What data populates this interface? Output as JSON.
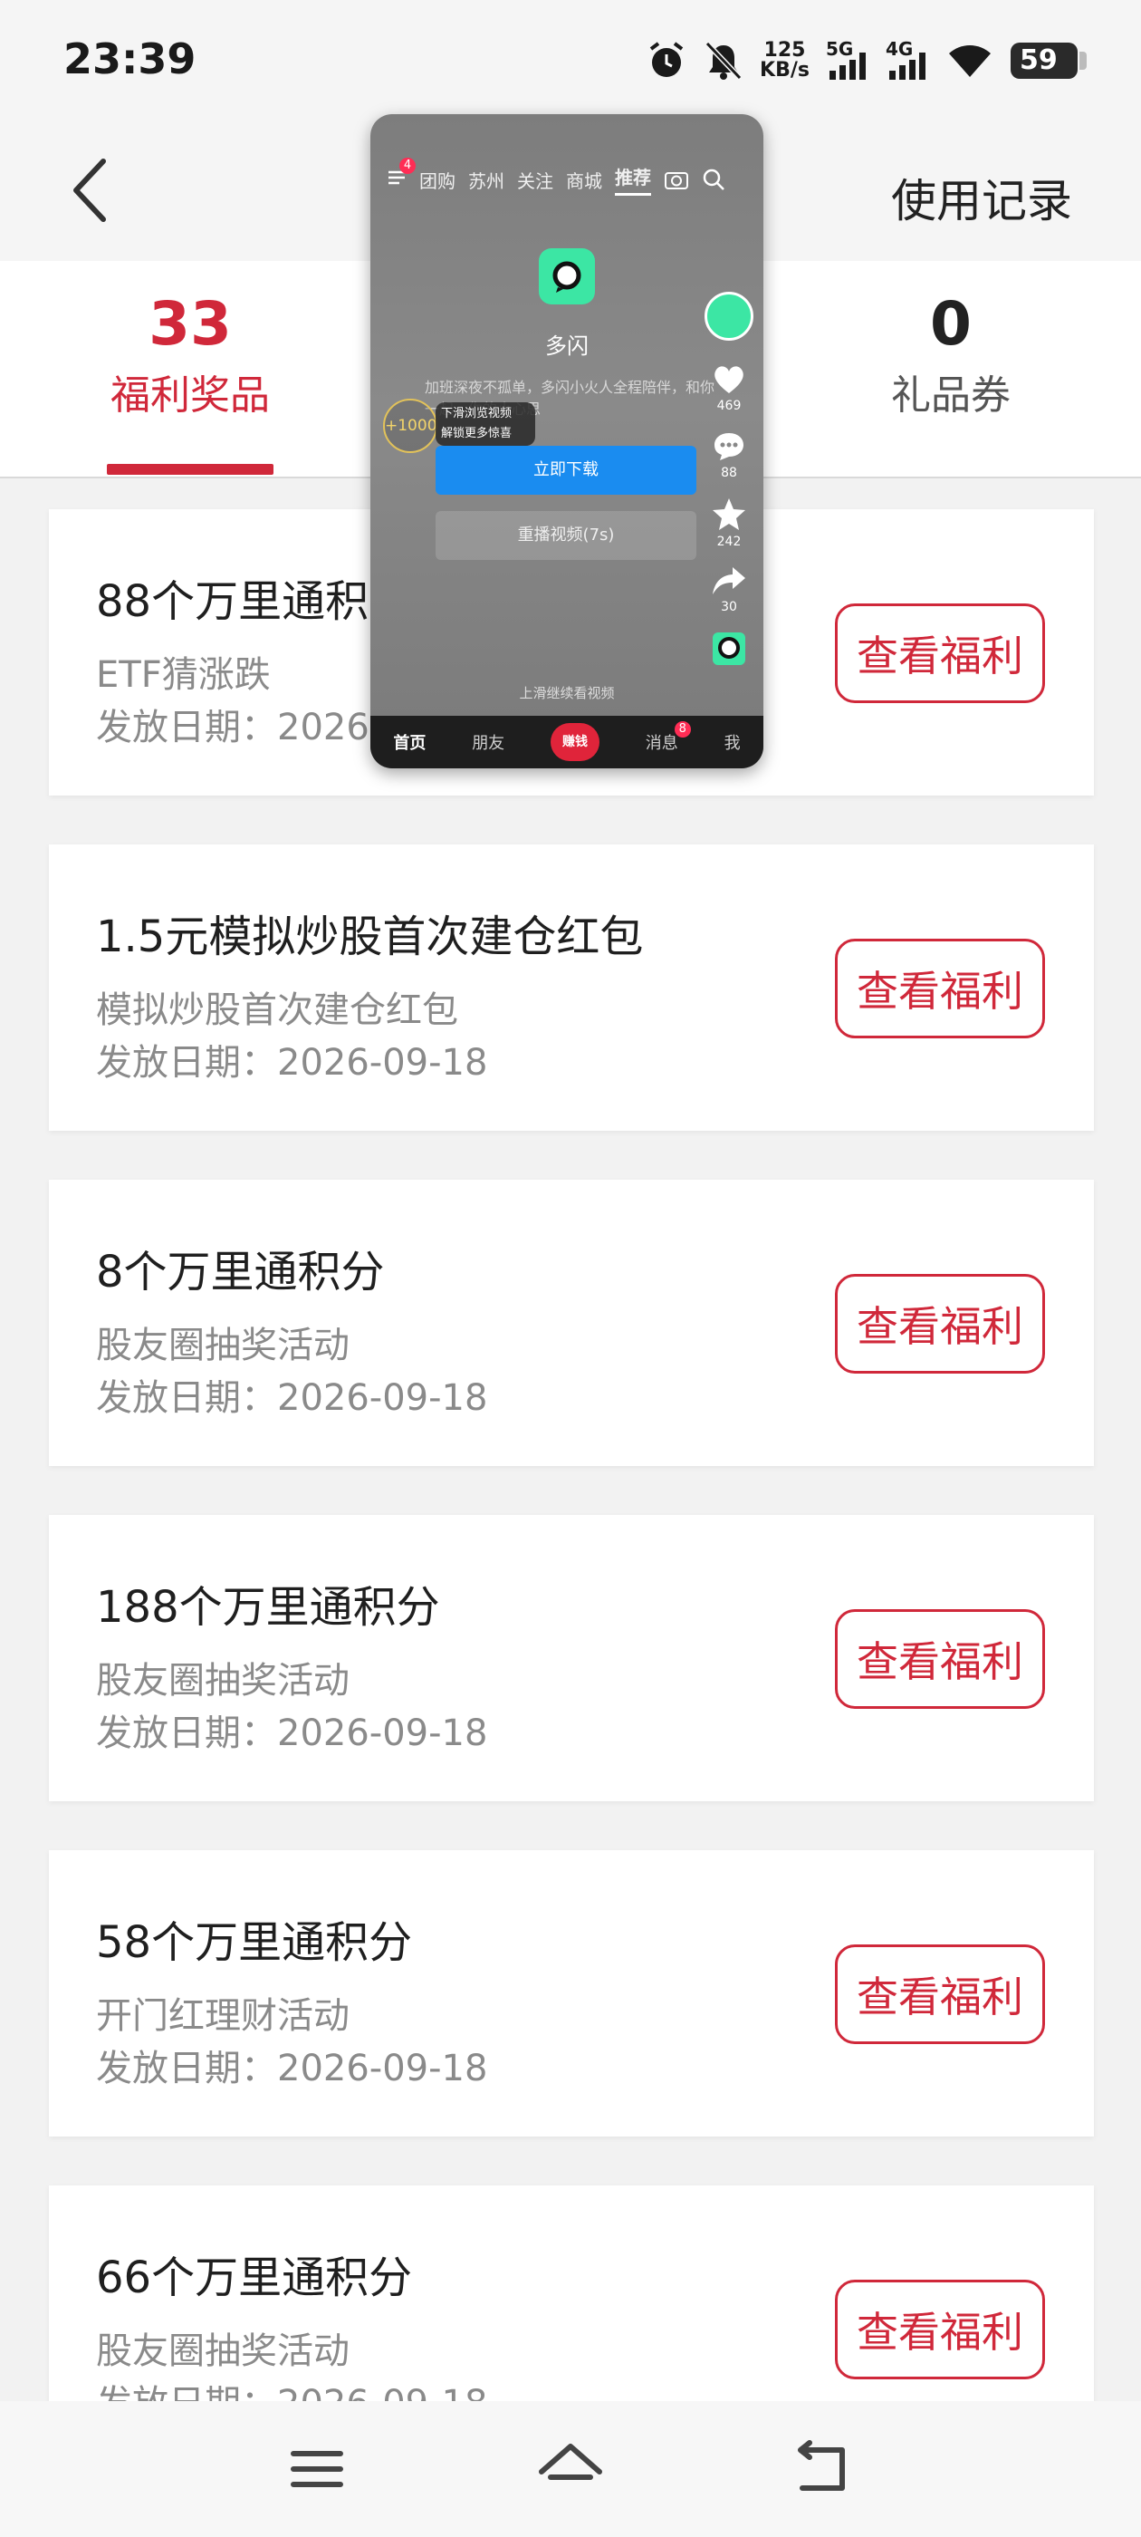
{
  "status_bar": {
    "time": "23:39",
    "net_speed_value": "125",
    "net_speed_unit": "KB/s",
    "sig1_label": "5G",
    "sig2_label": "4G",
    "battery": "59",
    "icons": [
      "alarm-icon",
      "mute-bell-icon",
      "signal-5g-icon",
      "signal-4g-icon",
      "wifi-icon",
      "battery-icon"
    ]
  },
  "header": {
    "right_label": "使用记录"
  },
  "tabs": [
    {
      "count": "33",
      "label": "福利奖品",
      "active": true
    },
    {
      "count": "0",
      "label": "礼品券",
      "active": false
    }
  ],
  "items": [
    {
      "title": "88个万里通积",
      "subtitle": "ETF猜涨跌",
      "date": "发放日期：2026-",
      "button": "查看福利"
    },
    {
      "title": "1.5元模拟炒股首次建仓红包",
      "subtitle": "模拟炒股首次建仓红包",
      "date": "发放日期：2026-09-18",
      "button": "查看福利"
    },
    {
      "title": "8个万里通积分",
      "subtitle": "股友圈抽奖活动",
      "date": "发放日期：2026-09-18",
      "button": "查看福利"
    },
    {
      "title": "188个万里通积分",
      "subtitle": "股友圈抽奖活动",
      "date": "发放日期：2026-09-18",
      "button": "查看福利"
    },
    {
      "title": "58个万里通积分",
      "subtitle": "开门红理财活动",
      "date": "发放日期：2026-09-18",
      "button": "查看福利"
    },
    {
      "title": "66个万里通积分",
      "subtitle": "股友圈抽奖活动",
      "date": "发放日期：2026-09-18",
      "button": "查看福利"
    }
  ],
  "overlay": {
    "top_tabs": [
      "团购",
      "苏州",
      "关注",
      "商城",
      "推荐"
    ],
    "menu_badge": "4",
    "app_name": "多闪",
    "description": "加班深夜不孤单，多闪小火人全程陪伴，和你一起…你的小心思",
    "coin_label": "+1000",
    "coin_tip_line1": "下滑浏览视频",
    "coin_tip_line2": "解锁更多惊喜",
    "download_label": "立即下载",
    "replay_label": "重播视频(7s)",
    "side_counts": [
      "469",
      "88",
      "242",
      "30"
    ],
    "swipe_hint": "上滑继续看视频",
    "bottom_tabs": [
      "首页",
      "朋友",
      "赚钱",
      "消息",
      "我"
    ],
    "msg_badge": "8"
  }
}
